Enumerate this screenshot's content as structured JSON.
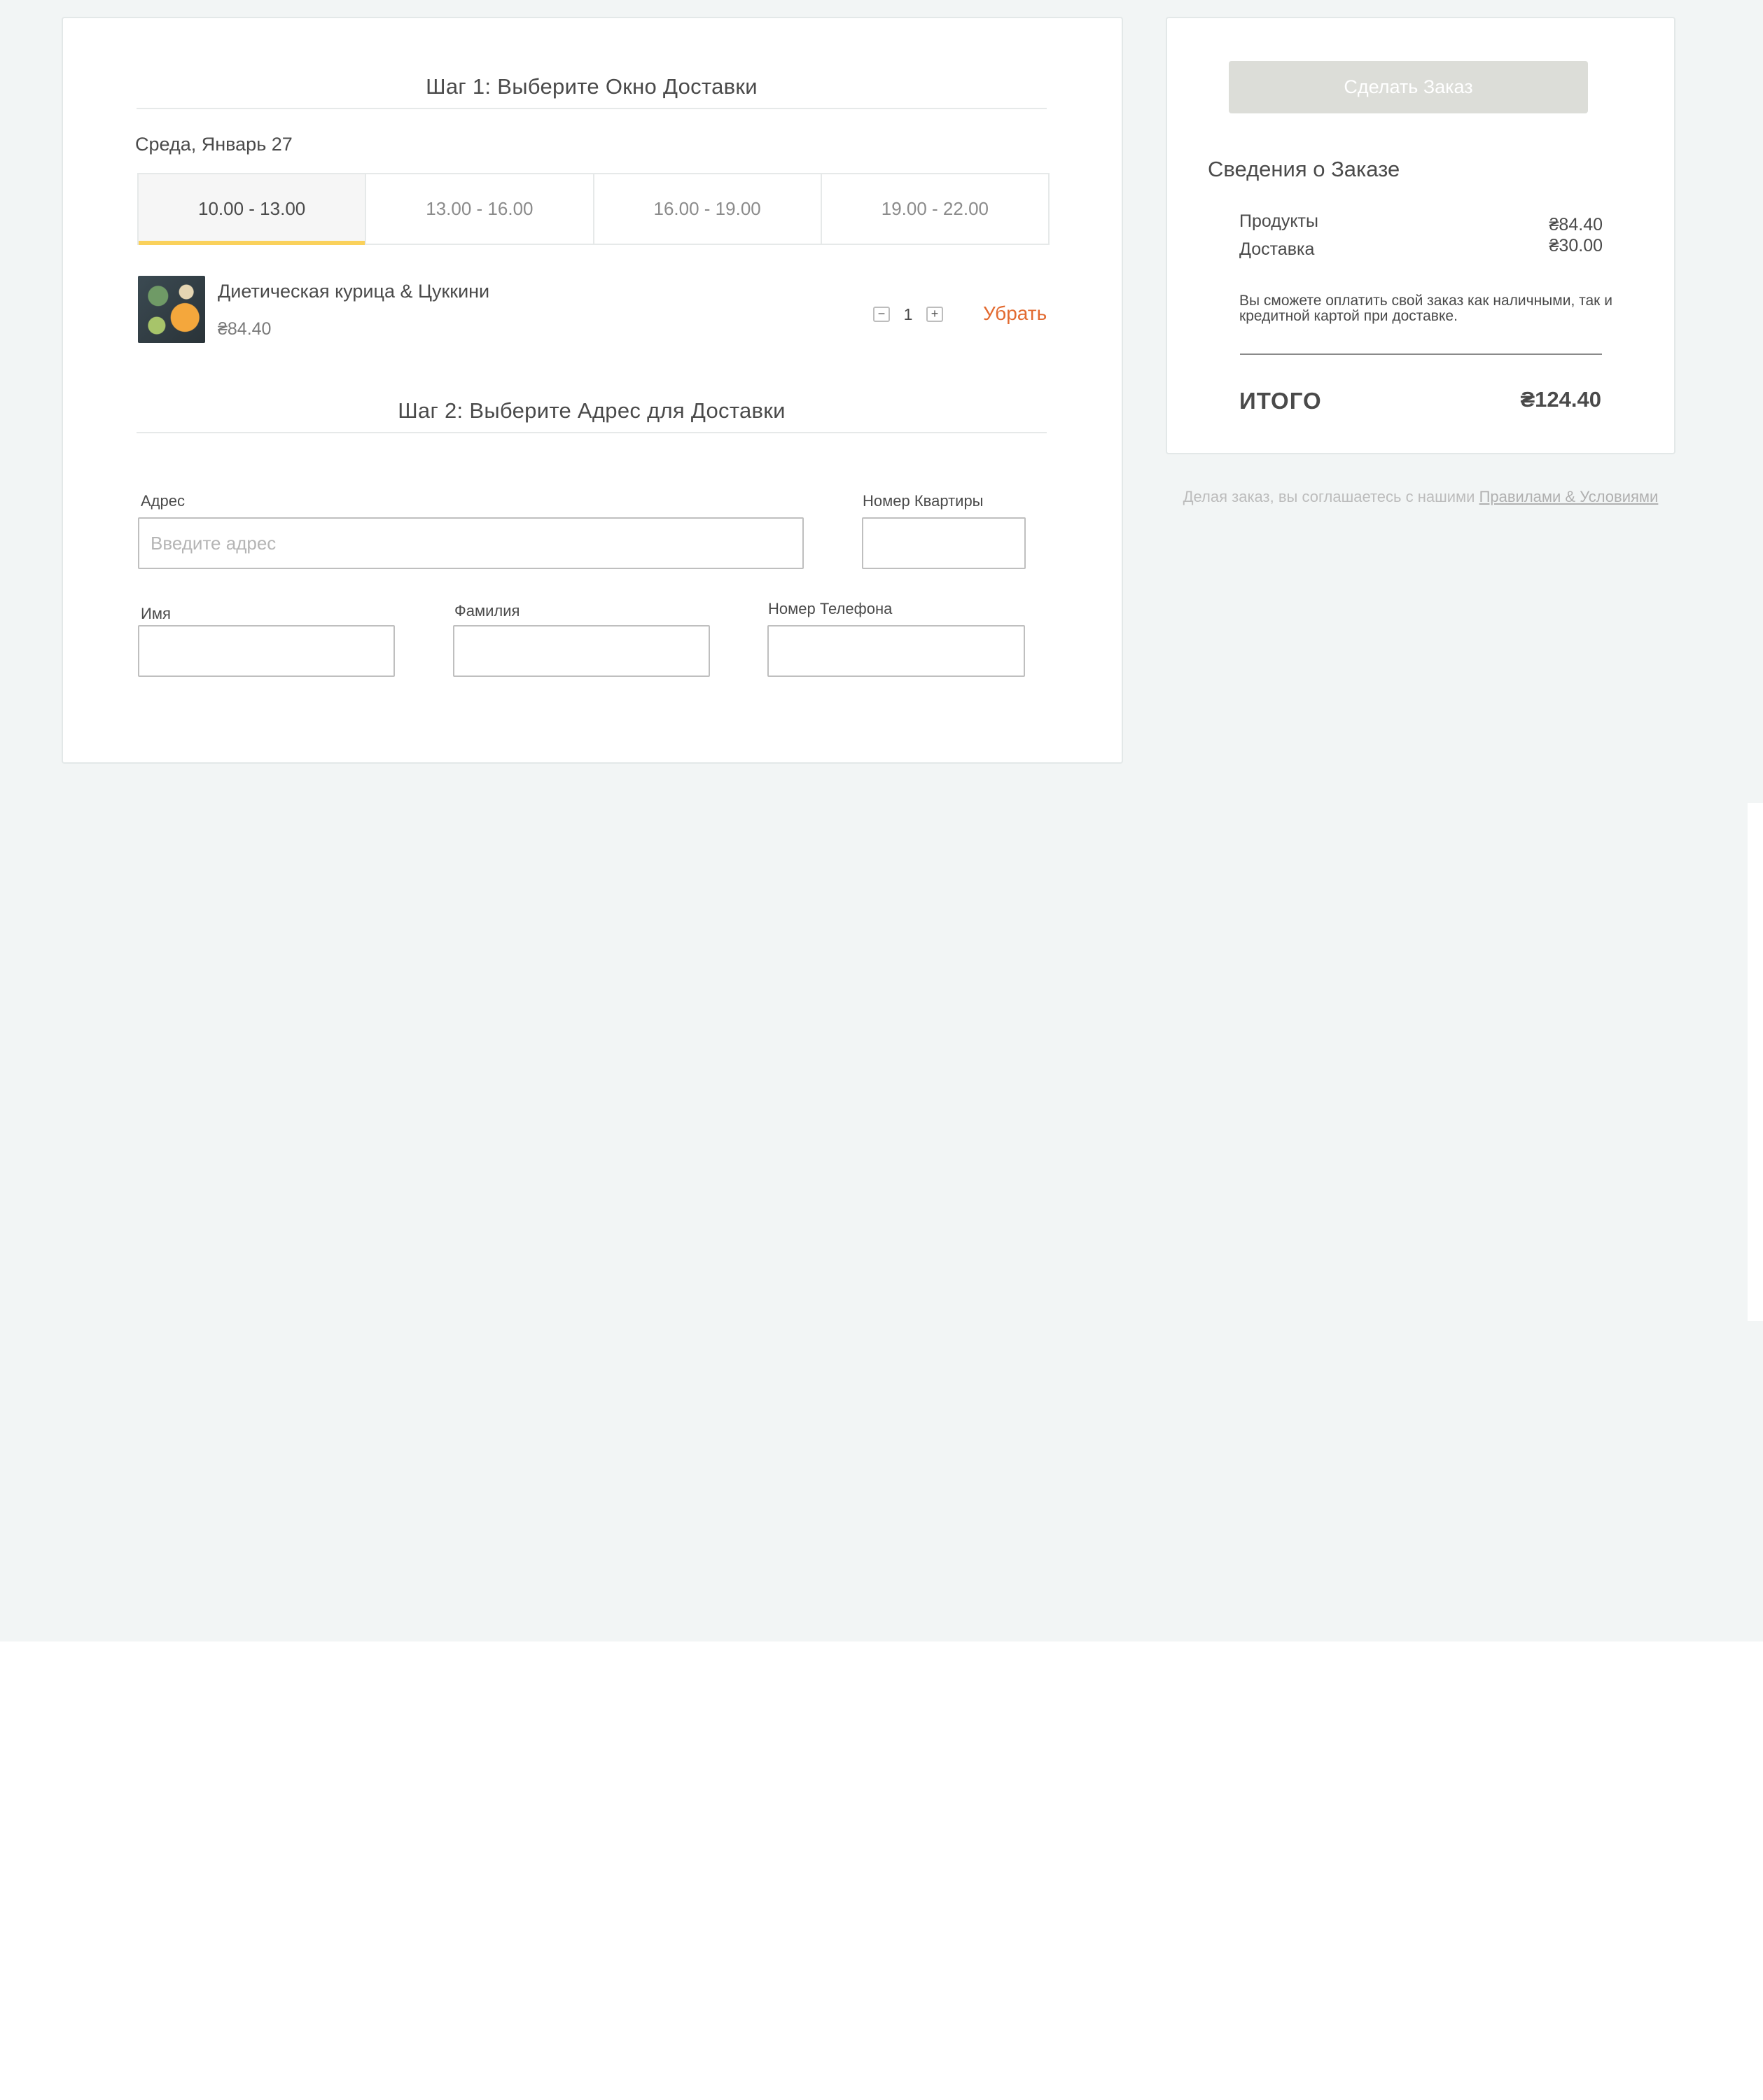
{
  "step1": {
    "title": "Шаг 1: Выберите Окно Доставки",
    "date": "Среда, Январь 27",
    "slots": [
      "10.00 - 13.00",
      "13.00 - 16.00",
      "16.00 - 19.00",
      "19.00 - 22.00"
    ],
    "active_slot": "10.00 - 13.00"
  },
  "cart_item": {
    "name": "Диетическая курица & Цуккини",
    "price": "₴84.40",
    "quantity": "1",
    "minus_label": "−",
    "plus_label": "+",
    "remove_label": "Убрать"
  },
  "step2": {
    "title": "Шаг 2: Выберите Адрес для Доставки",
    "address_label": "Адрес",
    "address_placeholder": "Введите адрес",
    "apartment_label": "Номер Квартиры",
    "first_name_label": "Имя",
    "last_name_label": "Фамилия",
    "phone_label": "Номер Телефона"
  },
  "summary": {
    "order_button": "Сделать Заказ",
    "title": "Сведения о Заказе",
    "products_label": "Продукты",
    "products_value": "₴84.40",
    "delivery_label": "Доставка",
    "delivery_value": "₴30.00",
    "payment_note": "Вы сможете оплатить свой заказ как наличными, так и кредитной картой при доставке.",
    "total_label": "ИТОГО",
    "total_value": "₴124.40"
  },
  "terms": {
    "prefix": "Делая заказ, вы соглашаетесь с нашими",
    "link": "Правилами & Условиями"
  },
  "colors": {
    "accent": "#fad15b",
    "remove_link": "#e26a30",
    "disabled_button": "#dcddd8",
    "page_background": "#f2f5f5"
  }
}
